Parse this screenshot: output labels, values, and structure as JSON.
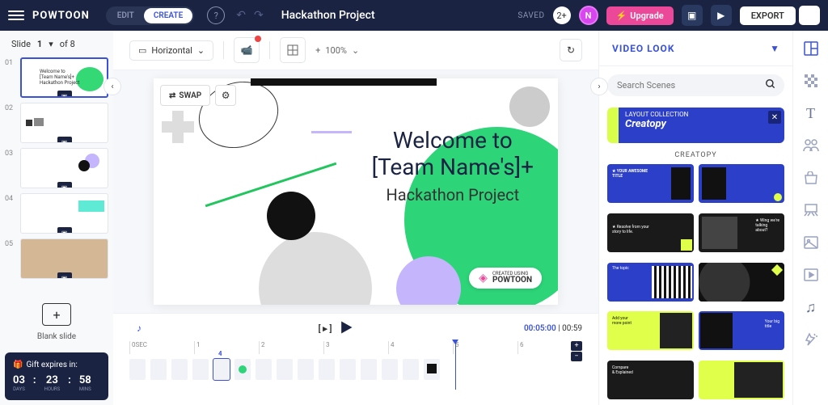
{
  "header": {
    "logo": "POWTOON",
    "edit_label": "EDIT",
    "create_label": "CREATE",
    "project_title": "Hackathon Project",
    "saved_label": "SAVED",
    "user_initial": "N",
    "upgrade_label": "Upgrade",
    "export_label": "EXPORT"
  },
  "slides": {
    "label": "Slide",
    "current": "1",
    "of_label": "of 8",
    "items": [
      "01",
      "02",
      "03",
      "04",
      "05"
    ],
    "blank_label": "Blank slide"
  },
  "gift": {
    "title": "Gift expires in:",
    "days": "03",
    "hours": "23",
    "mins": "58",
    "days_label": "DAYS",
    "hours_label": "HOURS",
    "mins_label": "MINS"
  },
  "toolbar": {
    "orientation": "Horizontal",
    "zoom": "100%",
    "swap_label": "SWAP"
  },
  "canvas": {
    "line1": "Welcome to",
    "line2": "[Team Name's]+",
    "line3": "Hackathon Project",
    "badge_prefix": "CREATED USING",
    "badge_brand": "POWTOON"
  },
  "timeline": {
    "current_time": "00:05:00",
    "total_time": "00:59",
    "ruler": [
      "0SEC",
      "1",
      "2",
      "3",
      "4",
      "5",
      "6"
    ]
  },
  "right": {
    "title": "VIDEO LOOK",
    "search_placeholder": "Search Scenes",
    "collection_tag": "LAYOUT COLLECTION",
    "collection_name": "Creatopy",
    "collection_label": "CREATOPY"
  }
}
